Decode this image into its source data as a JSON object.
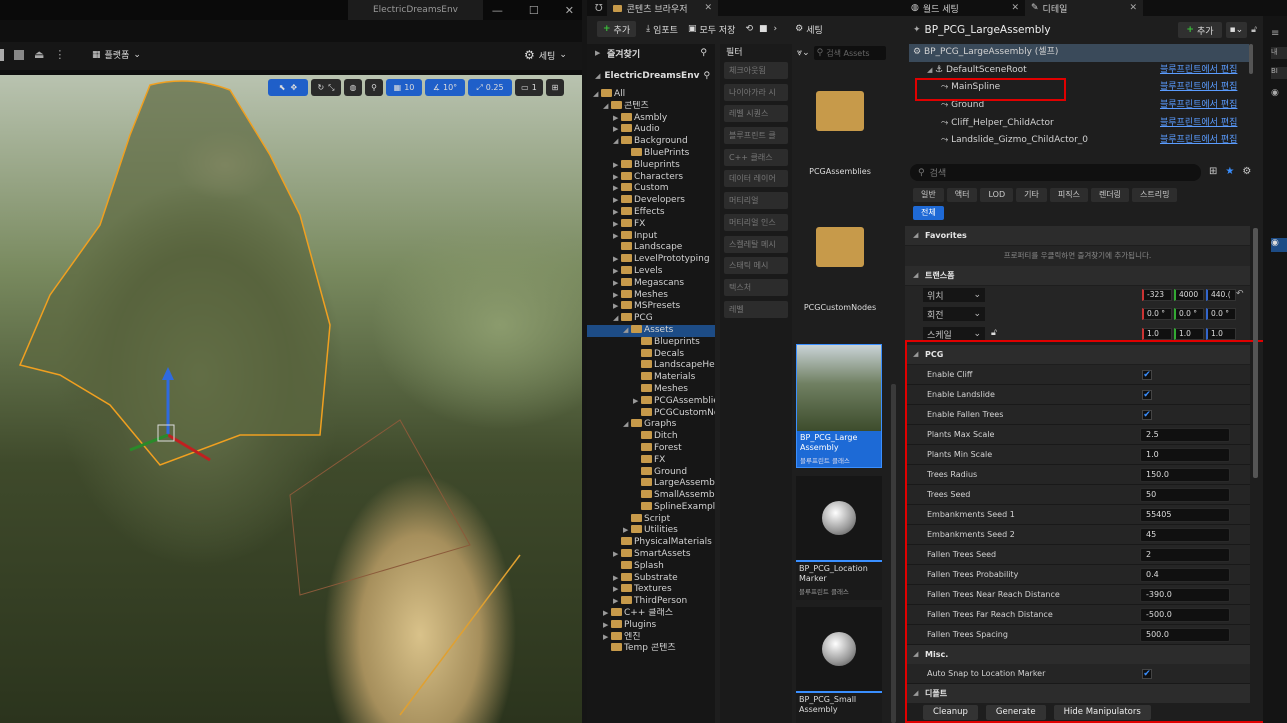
{
  "editor": {
    "project_title": "ElectricDreamsEnv",
    "window_controls": [
      "—",
      "☐",
      "✕"
    ],
    "platforms_label": "플랫폼",
    "settings_label": "세팅",
    "viewport": {
      "grid_snap": "10",
      "rot_snap": "10°",
      "scale_snap": "0.25",
      "camera_speed": "1"
    }
  },
  "content_browser": {
    "tab_label": "콘텐츠 브라우저",
    "add_label": "추가",
    "import_label": "임포트",
    "save_all_label": "모두 저장",
    "settings_label": "세팅",
    "favorites_label": "즐겨찾기",
    "project_label": "ElectricDreamsEnv",
    "filters_label": "필터",
    "search_placeholder": "검색 Assets",
    "tree": [
      {
        "label": "All",
        "depth": 0,
        "arrow": "◢"
      },
      {
        "label": "콘텐츠",
        "depth": 1,
        "arrow": "◢"
      },
      {
        "label": "Asmbly",
        "depth": 2,
        "arrow": "▶"
      },
      {
        "label": "Audio",
        "depth": 2,
        "arrow": "▶"
      },
      {
        "label": "Background",
        "depth": 2,
        "arrow": "◢"
      },
      {
        "label": "BluePrints",
        "depth": 3,
        "arrow": ""
      },
      {
        "label": "Blueprints",
        "depth": 2,
        "arrow": "▶"
      },
      {
        "label": "Characters",
        "depth": 2,
        "arrow": "▶"
      },
      {
        "label": "Custom",
        "depth": 2,
        "arrow": "▶"
      },
      {
        "label": "Developers",
        "depth": 2,
        "arrow": "▶"
      },
      {
        "label": "Effects",
        "depth": 2,
        "arrow": "▶"
      },
      {
        "label": "FX",
        "depth": 2,
        "arrow": "▶"
      },
      {
        "label": "Input",
        "depth": 2,
        "arrow": "▶"
      },
      {
        "label": "Landscape",
        "depth": 2,
        "arrow": ""
      },
      {
        "label": "LevelPrototyping",
        "depth": 2,
        "arrow": "▶"
      },
      {
        "label": "Levels",
        "depth": 2,
        "arrow": "▶"
      },
      {
        "label": "Megascans",
        "depth": 2,
        "arrow": "▶"
      },
      {
        "label": "Meshes",
        "depth": 2,
        "arrow": "▶"
      },
      {
        "label": "MSPresets",
        "depth": 2,
        "arrow": "▶"
      },
      {
        "label": "PCG",
        "depth": 2,
        "arrow": "◢"
      },
      {
        "label": "Assets",
        "depth": 3,
        "arrow": "◢",
        "selected": true
      },
      {
        "label": "Blueprints",
        "depth": 4,
        "arrow": ""
      },
      {
        "label": "Decals",
        "depth": 4,
        "arrow": ""
      },
      {
        "label": "LandscapeHeig",
        "depth": 4,
        "arrow": ""
      },
      {
        "label": "Materials",
        "depth": 4,
        "arrow": ""
      },
      {
        "label": "Meshes",
        "depth": 4,
        "arrow": ""
      },
      {
        "label": "PCGAssemblies",
        "depth": 4,
        "arrow": "▶"
      },
      {
        "label": "PCGCustomNoc",
        "depth": 4,
        "arrow": ""
      },
      {
        "label": "Graphs",
        "depth": 3,
        "arrow": "◢"
      },
      {
        "label": "Ditch",
        "depth": 4,
        "arrow": ""
      },
      {
        "label": "Forest",
        "depth": 4,
        "arrow": ""
      },
      {
        "label": "FX",
        "depth": 4,
        "arrow": ""
      },
      {
        "label": "Ground",
        "depth": 4,
        "arrow": ""
      },
      {
        "label": "LargeAssembly",
        "depth": 4,
        "arrow": ""
      },
      {
        "label": "SmallAssembly",
        "depth": 4,
        "arrow": ""
      },
      {
        "label": "SplineExample",
        "depth": 4,
        "arrow": ""
      },
      {
        "label": "Script",
        "depth": 3,
        "arrow": ""
      },
      {
        "label": "Utilities",
        "depth": 3,
        "arrow": "▶"
      },
      {
        "label": "PhysicalMaterials",
        "depth": 2,
        "arrow": ""
      },
      {
        "label": "SmartAssets",
        "depth": 2,
        "arrow": "▶"
      },
      {
        "label": "Splash",
        "depth": 2,
        "arrow": ""
      },
      {
        "label": "Substrate",
        "depth": 2,
        "arrow": "▶"
      },
      {
        "label": "Textures",
        "depth": 2,
        "arrow": "▶"
      },
      {
        "label": "ThirdPerson",
        "depth": 2,
        "arrow": "▶"
      },
      {
        "label": "C++ 클래스",
        "depth": 1,
        "arrow": "▶"
      },
      {
        "label": "Plugins",
        "depth": 1,
        "arrow": "▶"
      },
      {
        "label": "엔진",
        "depth": 1,
        "arrow": "▶"
      },
      {
        "label": "Temp 콘텐츠",
        "depth": 1,
        "arrow": ""
      }
    ],
    "filters": [
      "체크아웃됨",
      "나이아가라 시",
      "레벨 시퀀스",
      "블루프린트 클",
      "C++ 클래스",
      "데이터 레이어",
      "머티리얼",
      "머티리얼 인스",
      "스켈레탈 메시",
      "스태틱 메시",
      "텍스처",
      "레벨"
    ],
    "assets": [
      {
        "name": "PCGAssemblies",
        "kind": "folder"
      },
      {
        "name": "PCGCustomNodes",
        "kind": "folder"
      },
      {
        "name": "BP_PCG_Large Assembly",
        "type": "블루프린트 클래스",
        "kind": "thumb",
        "selected": true
      },
      {
        "name": "BP_PCG_Location Marker",
        "type": "블루프린트 클래스",
        "kind": "sphere"
      },
      {
        "name": "BP_PCG_Small Assembly",
        "type": "",
        "kind": "sphere"
      }
    ]
  },
  "world_settings": {
    "tab_label": "월드 세팅"
  },
  "details": {
    "tab_label": "디테일",
    "actor_name": "BP_PCG_LargeAssembly",
    "add_label": "추가",
    "components": [
      {
        "label": "BP_PCG_LargeAssembly (셀프)",
        "depth": 0,
        "link": "",
        "selected": true
      },
      {
        "label": "DefaultSceneRoot",
        "depth": 1,
        "link": "블루프린트에서 편집"
      },
      {
        "label": "MainSpline",
        "depth": 2,
        "link": "블루프린트에서 편집",
        "highlight": true
      },
      {
        "label": "Ground",
        "depth": 2,
        "link": "블루프린트에서 편집"
      },
      {
        "label": "Cliff_Helper_ChildActor",
        "depth": 2,
        "link": "블루프린트에서 편집"
      },
      {
        "label": "Landslide_Gizmo_ChildActor_0",
        "depth": 2,
        "link": "블루프린트에서 편집"
      }
    ],
    "search_placeholder": "검색",
    "categories": [
      "일반",
      "액터",
      "LOD",
      "기타",
      "피직스",
      "렌더링",
      "스트리밍"
    ],
    "all_category": "전체",
    "favorites_label": "Favorites",
    "favorites_hint": "프로퍼티를 우클릭하면 즐겨찾기에 추가됩니다.",
    "transform": {
      "label": "트랜스폼",
      "location_label": "위치",
      "location": [
        "-323",
        "4000",
        "440.("
      ],
      "rotation_label": "회전",
      "rotation": [
        "0.0 °",
        "0.0 °",
        "0.0 °"
      ],
      "scale_label": "스케일",
      "scale": [
        "1.0",
        "1.0",
        "1.0"
      ]
    },
    "pcg_section": "PCG",
    "pcg_props": [
      {
        "label": "Enable Cliff",
        "check": true
      },
      {
        "label": "Enable Landslide",
        "check": true
      },
      {
        "label": "Enable Fallen Trees",
        "check": true
      },
      {
        "label": "Plants Max Scale",
        "value": "2.5"
      },
      {
        "label": "Plants Min Scale",
        "value": "1.0"
      },
      {
        "label": "Trees Radius",
        "value": "150.0"
      },
      {
        "label": "Trees Seed",
        "value": "50"
      },
      {
        "label": "Embankments Seed 1",
        "value": "55405"
      },
      {
        "label": "Embankments Seed 2",
        "value": "45"
      },
      {
        "label": "Fallen Trees Seed",
        "value": "2"
      },
      {
        "label": "Fallen Trees Probability",
        "value": "0.4"
      },
      {
        "label": "Fallen Trees Near Reach Distance",
        "value": "-390.0"
      },
      {
        "label": "Fallen Trees Far Reach Distance",
        "value": "-500.0"
      },
      {
        "label": "Fallen Trees Spacing",
        "value": "500.0"
      }
    ],
    "misc_section": "Misc.",
    "misc_props": [
      {
        "label": "Auto Snap to Location Marker",
        "check": true
      }
    ],
    "default_section": "디폴트",
    "buttons": [
      "Cleanup",
      "Generate",
      "Hide Manipulators"
    ]
  },
  "far_right": {
    "labels": [
      "내",
      "BI"
    ]
  },
  "colors": {
    "accent_blue": "#1f5fc9",
    "highlight_red": "#e00000",
    "selection_blue": "#1d4c86",
    "folder": "#c79a4a",
    "pcg_selection": "#ffa500"
  }
}
